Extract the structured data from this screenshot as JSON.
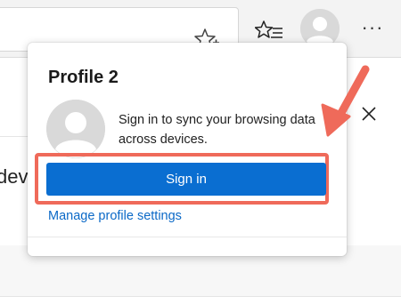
{
  "browser": {
    "more_label": "···"
  },
  "page": {
    "partial_text": "dev"
  },
  "profile_panel": {
    "title": "Profile 2",
    "message": "Sign in to sync your browsing data across devices.",
    "sign_in_label": "Sign in",
    "manage_link": "Manage profile settings"
  },
  "colors": {
    "accent": "#0a6ed1",
    "link": "#0b69c7",
    "annotation": "#ef6a5a"
  },
  "icons": {
    "address_bar": "star-add-icon",
    "toolbar_favorites": "favorites-list-icon",
    "toolbar_profile": "profile-avatar-icon",
    "toolbar_more": "more-icon",
    "panel_close": "close-icon",
    "panel_avatar": "profile-avatar-icon"
  }
}
